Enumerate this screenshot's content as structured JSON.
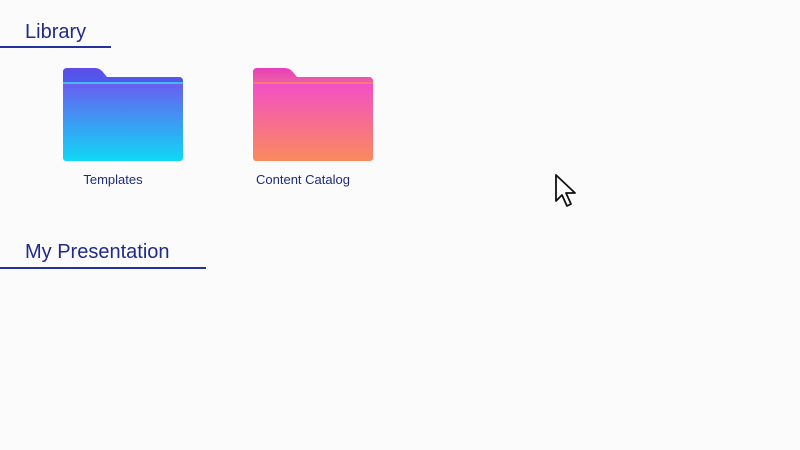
{
  "library": {
    "heading": "Library",
    "folders": [
      {
        "label": "Templates",
        "icon": "folder-icon",
        "gradient": [
          "#6a5cf0",
          "#0fd8f5"
        ]
      },
      {
        "label": "Content Catalog",
        "icon": "folder-icon",
        "gradient": [
          "#f24fc8",
          "#fb8a5c"
        ]
      }
    ]
  },
  "presentation": {
    "heading": "My Presentation"
  },
  "colors": {
    "heading_text": "#1f2a8a",
    "underline": "#2233a0",
    "background": "#fbfbfc"
  },
  "cursor": {
    "icon": "arrow-pointer-icon"
  }
}
